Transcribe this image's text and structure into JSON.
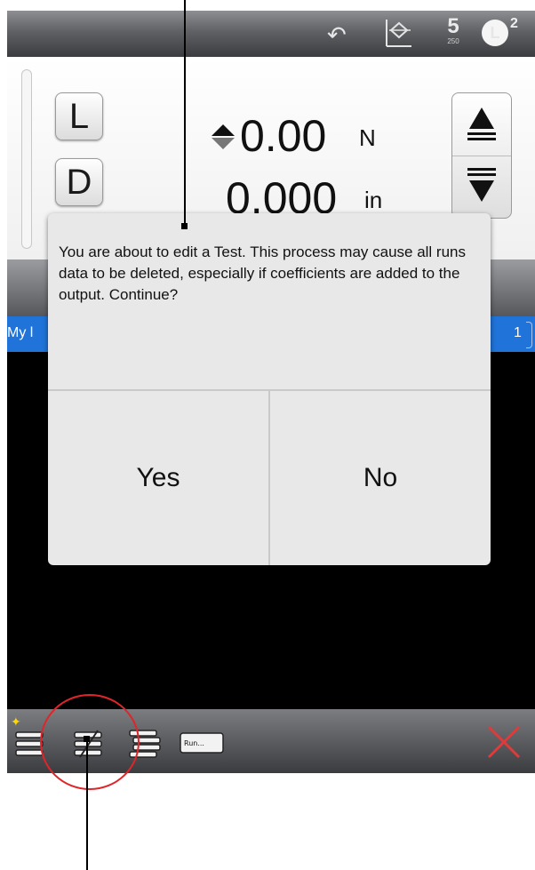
{
  "topbar": {
    "icons": [
      "undo-icon",
      "axis-icon",
      "statistics-icon",
      "load-cell-icon"
    ],
    "stat_number": "5",
    "stat_small": "250",
    "load_letter": "L",
    "load_superscript": "2"
  },
  "readout": {
    "load_button": "L",
    "displacement_button": "D",
    "force_value": "0.00",
    "force_unit": "N",
    "displacement_value": "0.000",
    "displacement_unit": "in"
  },
  "list": {
    "row_left_text": "My l",
    "row_right_text": "1"
  },
  "dialog": {
    "message": "You are about to edit a Test. This process may cause all runs data to be deleted, especially if coefficients are added to the output. Continue?",
    "yes_label": "Yes",
    "no_label": "No"
  },
  "toolbar": {
    "icons": [
      "new-test-icon",
      "edit-test-icon",
      "test-list-icon",
      "run-icon",
      "cancel-icon"
    ],
    "run_label": "Run..."
  },
  "colors": {
    "accent_blue": "#1f73d9",
    "highlight_red": "#e0252a",
    "cancel_red": "#e03a3a"
  }
}
